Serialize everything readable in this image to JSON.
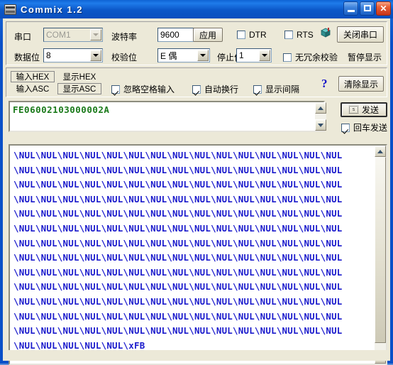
{
  "window": {
    "title": "Commix 1.2",
    "icon": "serial-terminal-icon",
    "minimize": "_",
    "maximize": "□",
    "close": "✕"
  },
  "settings": {
    "port_label": "串口",
    "port_value": "COM1",
    "baud_label": "波特率",
    "baud_value": "9600",
    "apply_label": "应用",
    "databits_label": "数据位",
    "databits_value": "8",
    "parity_label": "校验位",
    "parity_value": "E 偶",
    "stopbits_label": "停止位",
    "stopbits_value": "1",
    "dtr_label": "DTR",
    "dtr_checked": false,
    "rts_label": "RTS",
    "rts_checked": false,
    "noredundancy_label": "无冗余校验",
    "noredundancy_checked": false,
    "pause_label": "暂停显示",
    "close_port_label": "关闭串口",
    "net_icon": "network-cube-icon"
  },
  "format": {
    "input_hex": "输入HEX",
    "input_asc": "输入ASC",
    "show_hex": "显示HEX",
    "show_asc": "显示ASC",
    "ignore_space_label": "忽略空格输入",
    "ignore_space_checked": true,
    "auto_wrap_label": "自动换行",
    "auto_wrap_checked": true,
    "show_interval_label": "显示间隔",
    "show_interval_checked": true,
    "help_label": "?",
    "clear_label": "清除显示"
  },
  "send": {
    "input_text": "FE06002103000002A",
    "button_label": "发送",
    "button_icon": "send-icon",
    "enter_send_label": "回车发送",
    "enter_send_checked": true
  },
  "output": {
    "lines": [
      "\\NUL\\NUL\\NUL\\NUL\\NUL\\NUL\\NUL\\NUL\\NUL\\NUL\\NUL\\NUL\\NUL\\NUL\\NUL",
      "\\NUL\\NUL\\NUL\\NUL\\NUL\\NUL\\NUL\\NUL\\NUL\\NUL\\NUL\\NUL\\NUL\\NUL\\NUL",
      "\\NUL\\NUL\\NUL\\NUL\\NUL\\NUL\\NUL\\NUL\\NUL\\NUL\\NUL\\NUL\\NUL\\NUL\\NUL",
      "\\NUL\\NUL\\NUL\\NUL\\NUL\\NUL\\NUL\\NUL\\NUL\\NUL\\NUL\\NUL\\NUL\\NUL\\NUL",
      "\\NUL\\NUL\\NUL\\NUL\\NUL\\NUL\\NUL\\NUL\\NUL\\NUL\\NUL\\NUL\\NUL\\NUL\\NUL",
      "\\NUL\\NUL\\NUL\\NUL\\NUL\\NUL\\NUL\\NUL\\NUL\\NUL\\NUL\\NUL\\NUL\\NUL\\NUL",
      "\\NUL\\NUL\\NUL\\NUL\\NUL\\NUL\\NUL\\NUL\\NUL\\NUL\\NUL\\NUL\\NUL\\NUL\\NUL",
      "\\NUL\\NUL\\NUL\\NUL\\NUL\\NUL\\NUL\\NUL\\NUL\\NUL\\NUL\\NUL\\NUL\\NUL\\NUL",
      "\\NUL\\NUL\\NUL\\NUL\\NUL\\NUL\\NUL\\NUL\\NUL\\NUL\\NUL\\NUL\\NUL\\NUL\\NUL",
      "\\NUL\\NUL\\NUL\\NUL\\NUL\\NUL\\NUL\\NUL\\NUL\\NUL\\NUL\\NUL\\NUL\\NUL\\NUL",
      "\\NUL\\NUL\\NUL\\NUL\\NUL\\NUL\\NUL\\NUL\\NUL\\NUL\\NUL\\NUL\\NUL\\NUL\\NUL",
      "\\NUL\\NUL\\NUL\\NUL\\NUL\\NUL\\NUL\\NUL\\NUL\\NUL\\NUL\\NUL\\NUL\\NUL\\NUL",
      "\\NUL\\NUL\\NUL\\NUL\\NUL\\NUL\\NUL\\NUL\\NUL\\NUL\\NUL\\NUL\\NUL\\NUL\\NUL",
      "\\NUL\\NUL\\NUL\\NUL\\NUL\\xFB"
    ]
  },
  "colors": {
    "title_blue": "#0a50c8",
    "face": "#ece9d8",
    "input_text_green": "#1a7a1a",
    "output_text_blue": "#1a1acc",
    "help_blue": "#1616c8"
  }
}
